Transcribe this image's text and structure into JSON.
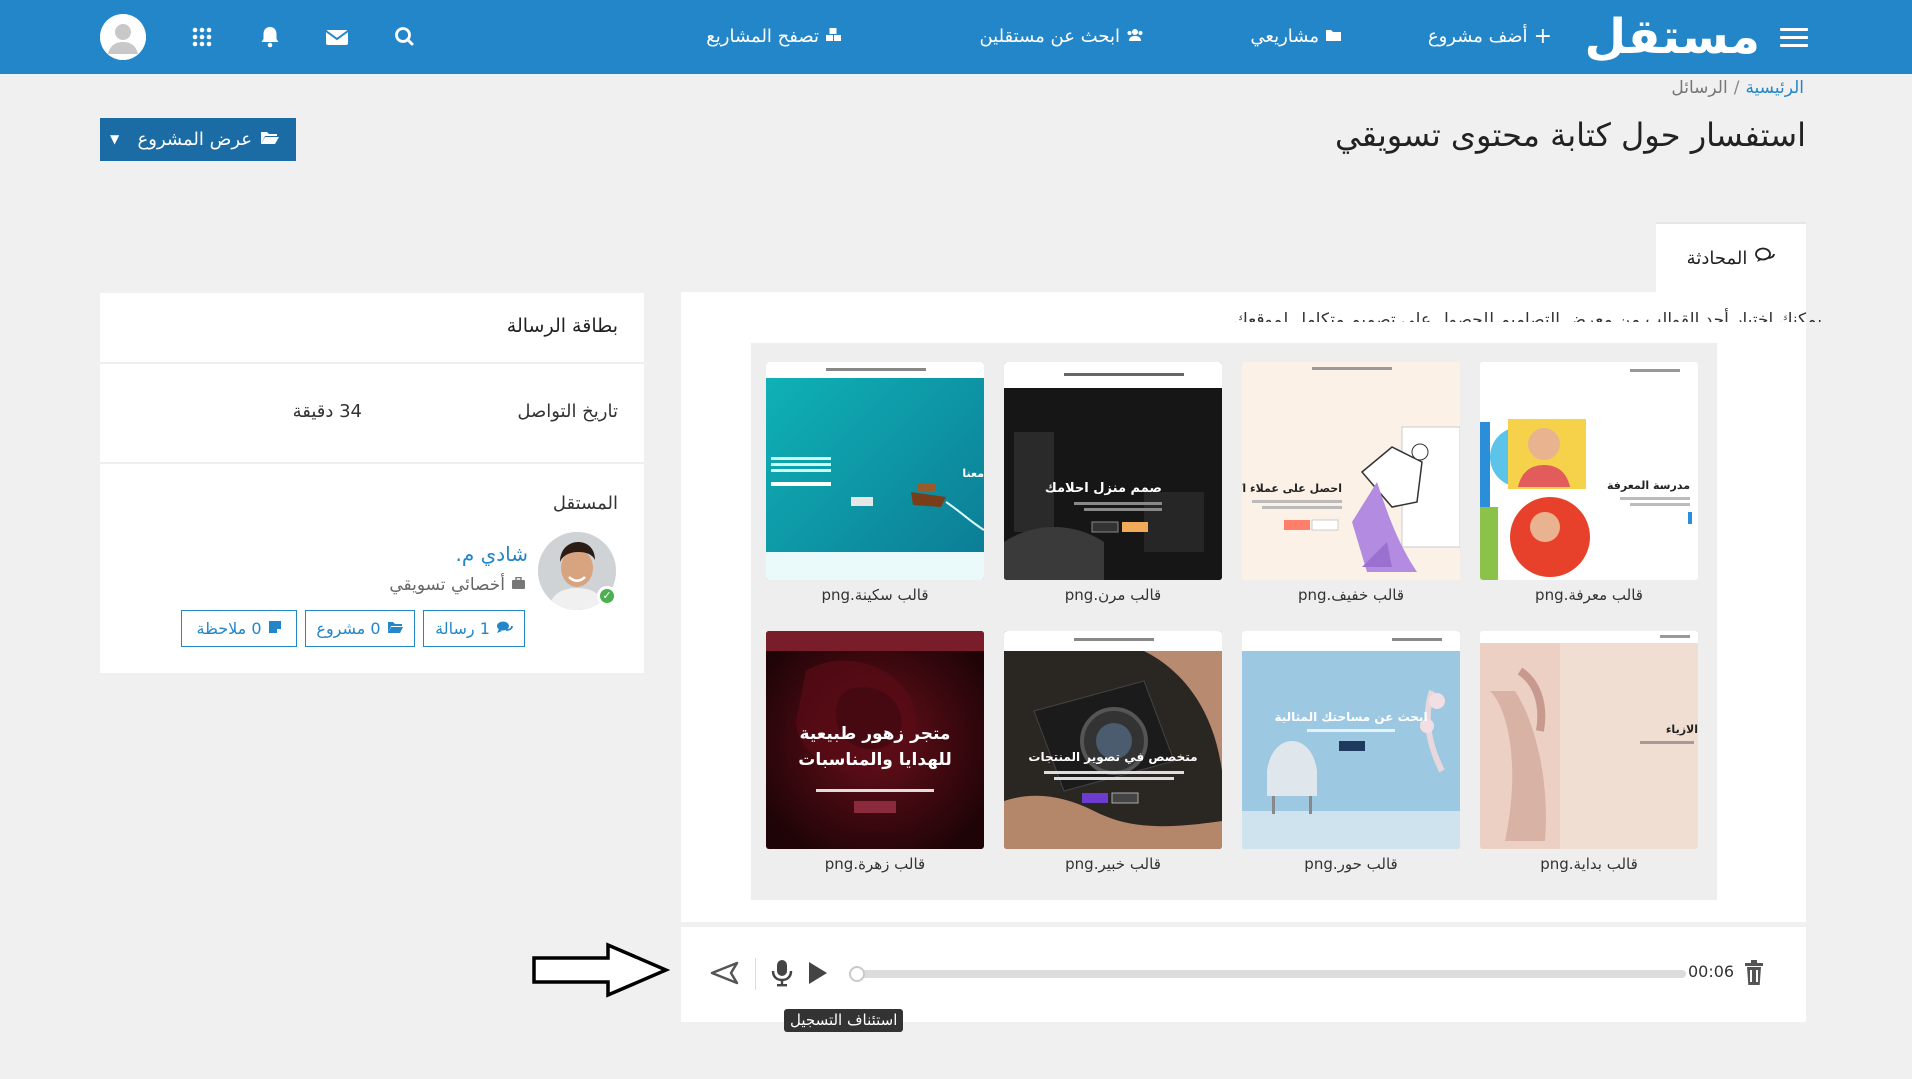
{
  "app": {
    "logo": "مستقل",
    "nav": {
      "add_project": "أضف مشروع",
      "my_projects": "مشاريعي",
      "find_freelancers": "ابحث عن مستقلين",
      "browse_projects": "تصفح المشاريع"
    }
  },
  "breadcrumb": {
    "home": "الرئيسية",
    "separator": "/",
    "current": "الرسائل"
  },
  "page": {
    "title": "استفسار حول كتابة محتوى تسويقي",
    "view_project_label": "عرض المشروع"
  },
  "chat": {
    "tab_label": "المحادثة",
    "message_fragment": "يمكنك اختيار أحد القوالب من معرض التصاميم للحصول على تصميم متكامل لموقعك",
    "attachments": [
      {
        "caption": "قالب معرفة.png",
        "heading": "مدرسة المعرفة",
        "theme": "school"
      },
      {
        "caption": "قالب خفيف.png",
        "heading": "احصل على عملاء اكثر",
        "theme": "light"
      },
      {
        "caption": "قالب مرن.png",
        "heading": "صمم منزل احلامك",
        "theme": "dark"
      },
      {
        "caption": "قالب سكينة.png",
        "heading": "معنا",
        "theme": "sea"
      },
      {
        "caption": "قالب بداية.png",
        "heading": "الازياء",
        "theme": "fashion"
      },
      {
        "caption": "قالب حور.png",
        "heading": "ابحث عن مساحتك المثالية",
        "theme": "home"
      },
      {
        "caption": "قالب خبير.png",
        "heading": "متخصص في تصوير المنتجات",
        "theme": "camera"
      },
      {
        "caption": "قالب زهرة.png",
        "heading": "متجر زهور طبيعية للهدايا والمناسبات",
        "theme": "rose"
      }
    ]
  },
  "recorder": {
    "time": "00:06",
    "progress": 0,
    "tooltip": "استئناف التسجيل"
  },
  "card": {
    "title": "بطاقة الرسالة",
    "contact_date_label": "تاريخ التواصل",
    "contact_date_value": "34 دقيقة",
    "freelancer_label": "المستقل",
    "freelancer": {
      "name": "شادي م.",
      "role": "أخصائي تسويقي",
      "messages": "1 رسالة",
      "projects": "0 مشروع",
      "notes": "0 ملاحظة"
    }
  },
  "colors": {
    "brand": "#2386c8",
    "brand_dark": "#1b6ba4",
    "background": "#f0f0f0",
    "online": "#4caf50"
  }
}
